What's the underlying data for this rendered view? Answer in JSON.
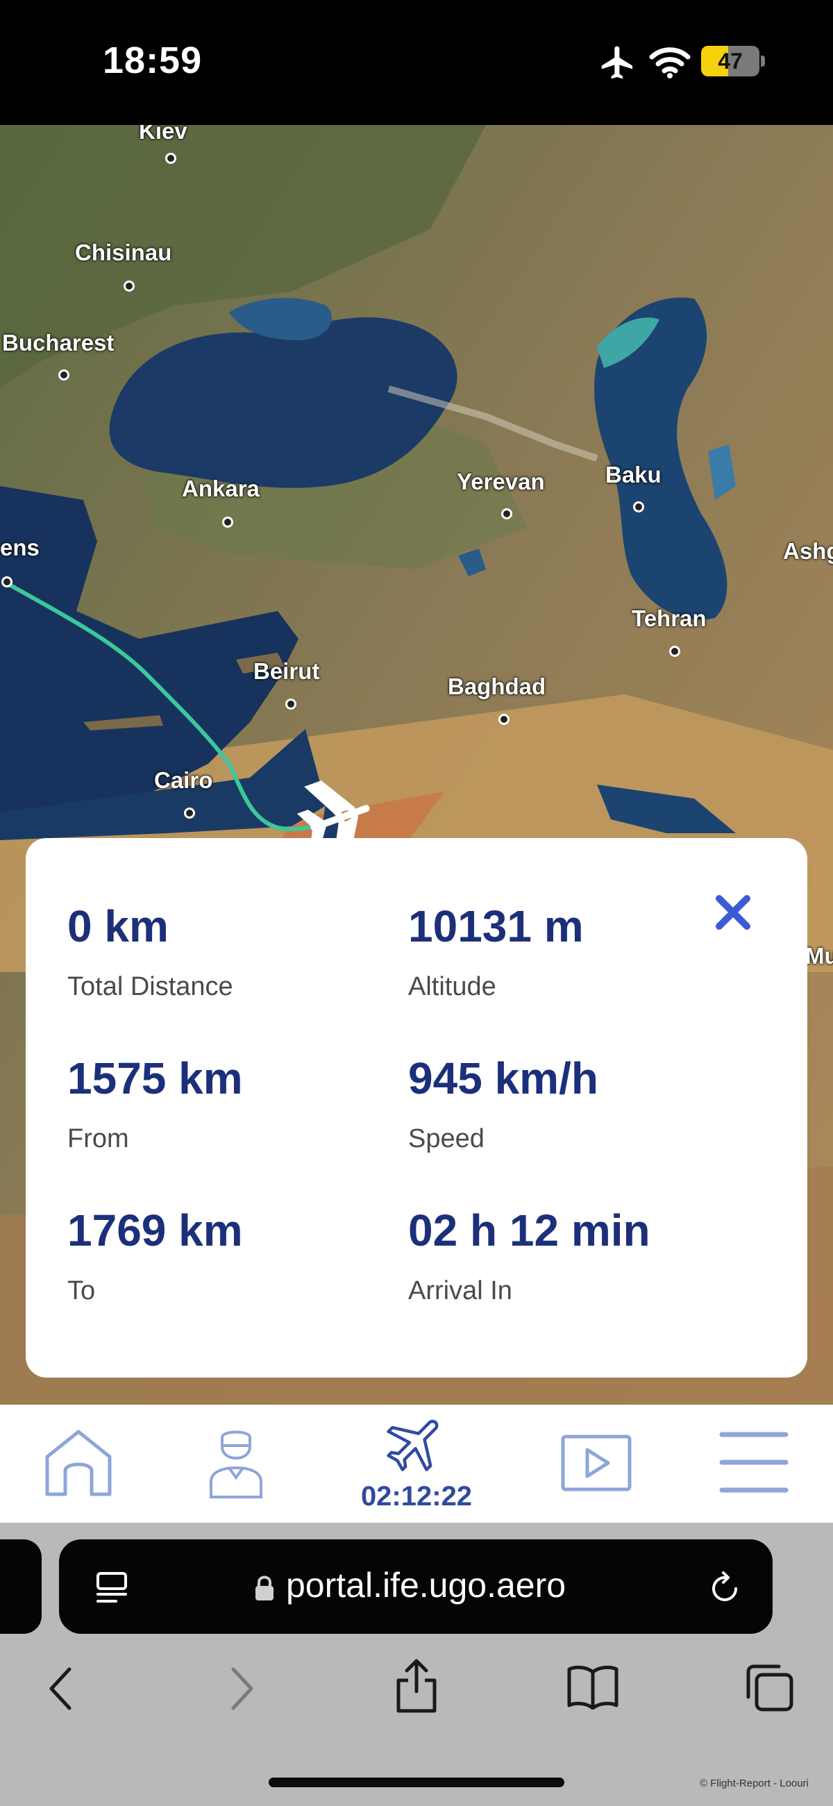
{
  "status_bar": {
    "time": "18:59",
    "battery_percent": 47,
    "battery_text": "47",
    "battery_color": "#f5d20b",
    "icons": [
      "airplane-mode-icon",
      "wifi-icon",
      "battery-icon"
    ]
  },
  "map": {
    "cities": [
      "Kiev",
      "Chisinau",
      "Bucharest",
      "Ankara",
      "Yerevan",
      "Baku",
      "ens",
      "Ashg",
      "Tehran",
      "Beirut",
      "Baghdad",
      "Cairo",
      "Mu"
    ],
    "route_color": "#3cc79a"
  },
  "flight_info": {
    "total_distance": {
      "value": "0 km",
      "label": "Total Distance"
    },
    "altitude": {
      "value": "10131 m",
      "label": "Altitude"
    },
    "from": {
      "value": "1575 km",
      "label": "From"
    },
    "speed": {
      "value": "945 km/h",
      "label": "Speed"
    },
    "to": {
      "value": "1769 km",
      "label": "To"
    },
    "arrival": {
      "value": "02 h 12 min",
      "label": "Arrival In"
    },
    "accent_color": "#1c2f7a",
    "close_icon": "close-icon"
  },
  "bottom_nav": {
    "items": [
      "home-icon",
      "pilot-icon",
      "airplane-icon",
      "play-icon",
      "menu-icon"
    ],
    "timer": "02:12:22",
    "color": "#8fa5d8"
  },
  "browser": {
    "url": "portal.ife.ugo.aero",
    "icons": [
      "reader-icon",
      "lock-icon",
      "reload-icon",
      "back-icon",
      "forward-icon",
      "share-icon",
      "bookmarks-icon",
      "tabs-icon"
    ]
  },
  "credit": "© Flight-Report - Loouri"
}
